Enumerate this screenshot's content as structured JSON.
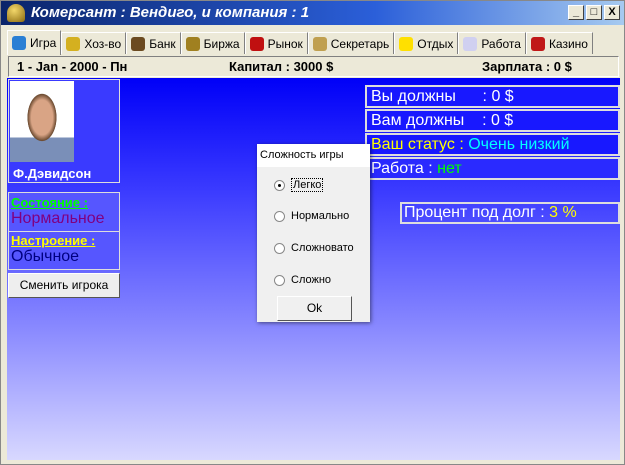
{
  "window": {
    "title": "Комерсант : Вендиго, и компания : 1",
    "minimize": "_",
    "maximize": "□",
    "close": "X"
  },
  "tabs": [
    {
      "label": "Игра",
      "icon": "globe-icon",
      "color": "#2a7fd4",
      "active": true
    },
    {
      "label": "Хоз-во",
      "icon": "keys-icon",
      "color": "#d4b020"
    },
    {
      "label": "Банк",
      "icon": "bank-icon",
      "color": "#6b4a20"
    },
    {
      "label": "Биржа",
      "icon": "briefcase-icon",
      "color": "#a08020"
    },
    {
      "label": "Рынок",
      "icon": "fruit-icon",
      "color": "#c01010"
    },
    {
      "label": "Секретарь",
      "icon": "inbox-icon",
      "color": "#c0a050"
    },
    {
      "label": "Отдых",
      "icon": "smiley-icon",
      "color": "#ffe000"
    },
    {
      "label": "Работа",
      "icon": "calendar-clock-icon",
      "color": "#d0d0f0"
    },
    {
      "label": "Казино",
      "icon": "roulette-icon",
      "color": "#c01818"
    }
  ],
  "status": {
    "date": "1 - Jan - 2000  - Пн",
    "capital": "Капитал : 3000 $",
    "salary": "Зарплата : 0 $"
  },
  "player": {
    "name": "Ф.Дэвидсон",
    "state_label": "Состояние :",
    "state_value": "Нормальное",
    "mood_label": "Настроение :",
    "mood_value": "Обычное",
    "change_button": "Сменить игрока"
  },
  "finance": {
    "you_owe_label": "Вы должны",
    "you_owe_value": "      : 0 $",
    "owed_label": "Вам должны",
    "owed_value": "    : 0 $",
    "status_label": "Ваш статус : ",
    "status_value": "Очень низкий",
    "job_label": "Работа : ",
    "job_value": "нет",
    "rate_label": "Процент под долг : ",
    "rate_value": "3 %"
  },
  "dialog": {
    "title": "Сложность игры",
    "options": [
      "Легко",
      "Нормально",
      "Сложновато",
      "Сложно"
    ],
    "selected": 0,
    "ok": "Ok"
  }
}
